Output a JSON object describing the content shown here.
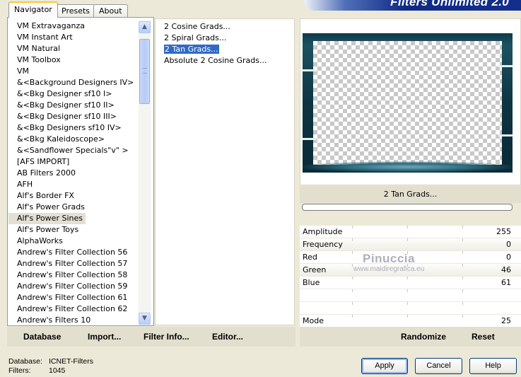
{
  "tabs": [
    "Navigator",
    "Presets",
    "About"
  ],
  "banner": "Filters Unlimited 2.0",
  "categories": [
    "VM Extravaganza",
    "VM Instant Art",
    "VM Natural",
    "VM Toolbox",
    "VM",
    "&<Background Designers IV>",
    "&<Bkg Designer sf10 I>",
    "&<Bkg Designer sf10 II>",
    "&<Bkg Designer sf10 III>",
    "&<Bkg Designers sf10 IV>",
    "&<Bkg Kaleidoscope>",
    "&<Sandflower Specials\"v\" >",
    "[AFS IMPORT]",
    "AB Filters 2000",
    "AFH",
    "Alf's Border FX",
    "Alf's Power Grads",
    "Alf's Power Sines",
    "Alf's Power Toys",
    "AlphaWorks",
    "Andrew's Filter Collection 56",
    "Andrew's Filter Collection 57",
    "Andrew's Filter Collection 58",
    "Andrew's Filter Collection 59",
    "Andrew's Filter Collection 61",
    "Andrew's Filter Collection 62",
    "Andrew's Filters 10"
  ],
  "selected_category_index": 17,
  "filters": [
    "2 Cosine Grads...",
    "2 Spiral Grads...",
    "2 Tan Grads...",
    "Absolute 2 Cosine Grads..."
  ],
  "selected_filter_index": 2,
  "current_filter": "2 Tan Grads...",
  "params": [
    {
      "label": "Amplitude",
      "value": "255"
    },
    {
      "label": "Frequency",
      "value": "0"
    },
    {
      "label": "Red",
      "value": "0"
    },
    {
      "label": "Green",
      "value": "46"
    },
    {
      "label": "Blue",
      "value": "61"
    },
    {
      "label": "",
      "value": ""
    },
    {
      "label": "",
      "value": ""
    },
    {
      "label": "Mode",
      "value": "25"
    }
  ],
  "watermark": {
    "line1": "Pinuccia",
    "line2": "www.maidiregrafica.eu"
  },
  "links": {
    "database": "Database",
    "import": "Import...",
    "filter_info": "Filter Info...",
    "editor": "Editor..."
  },
  "actions": {
    "randomize": "Randomize",
    "reset": "Reset"
  },
  "info": {
    "database_label": "Database:",
    "database_value": "ICNET-Filters",
    "filters_label": "Filters:",
    "filters_value": "1045"
  },
  "buttons": {
    "apply": "Apply",
    "cancel": "Cancel",
    "help": "Help"
  },
  "colors": {
    "selection": "#316ac5",
    "frame": "#0e3442",
    "banner": "#0f2a86"
  }
}
